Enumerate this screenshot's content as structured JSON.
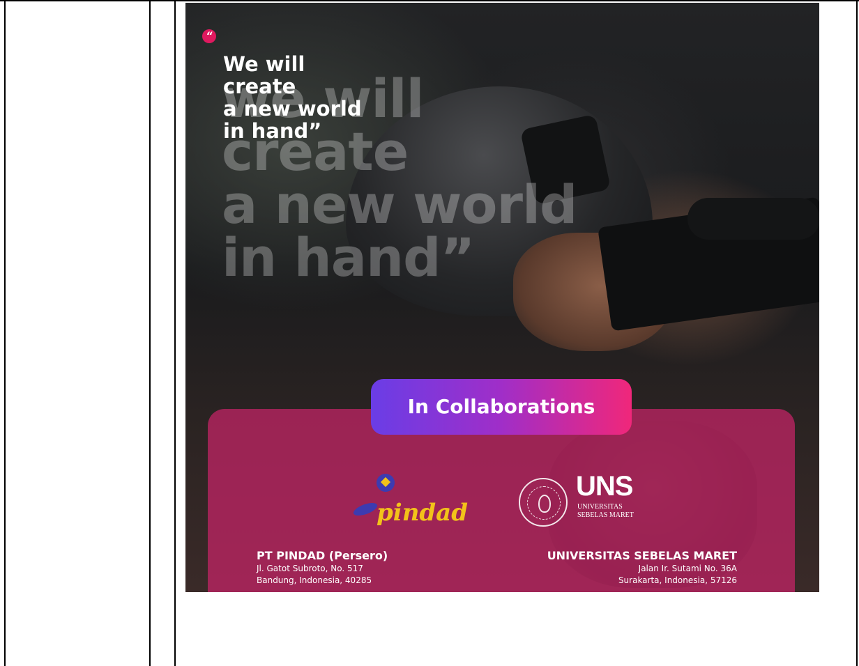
{
  "poster": {
    "quote_mark": "“",
    "headline": [
      "We will",
      "create",
      "a new world",
      "in hand”"
    ],
    "ghost_text": [
      "we will",
      "create",
      "a new world",
      "in hand”"
    ],
    "collab_label": "In Collaborations",
    "left_partner": {
      "logo_word": "pindad",
      "name": "PT PINDAD (Persero)",
      "address_1": "Jl. Gatot Subroto, No. 517",
      "address_2": "Bandung, Indonesia, 40285"
    },
    "right_partner": {
      "logo_word": "UNS",
      "logo_sub_1": "UNIVERSITAS",
      "logo_sub_2": "SEBELAS MARET",
      "name": "UNIVERSITAS SEBELAS MARET",
      "address_1": "Jalan Ir. Sutami No. 36A",
      "address_2": "Surakarta, Indonesia, 57126"
    },
    "colors": {
      "accent_pink": "#e0195f",
      "panel_magenta": "#c82468",
      "pill_gradient_start": "#6a3de6",
      "pill_gradient_end": "#f0277a",
      "pindad_yellow": "#f2c21a",
      "pindad_blue": "#3d3bb0"
    }
  }
}
